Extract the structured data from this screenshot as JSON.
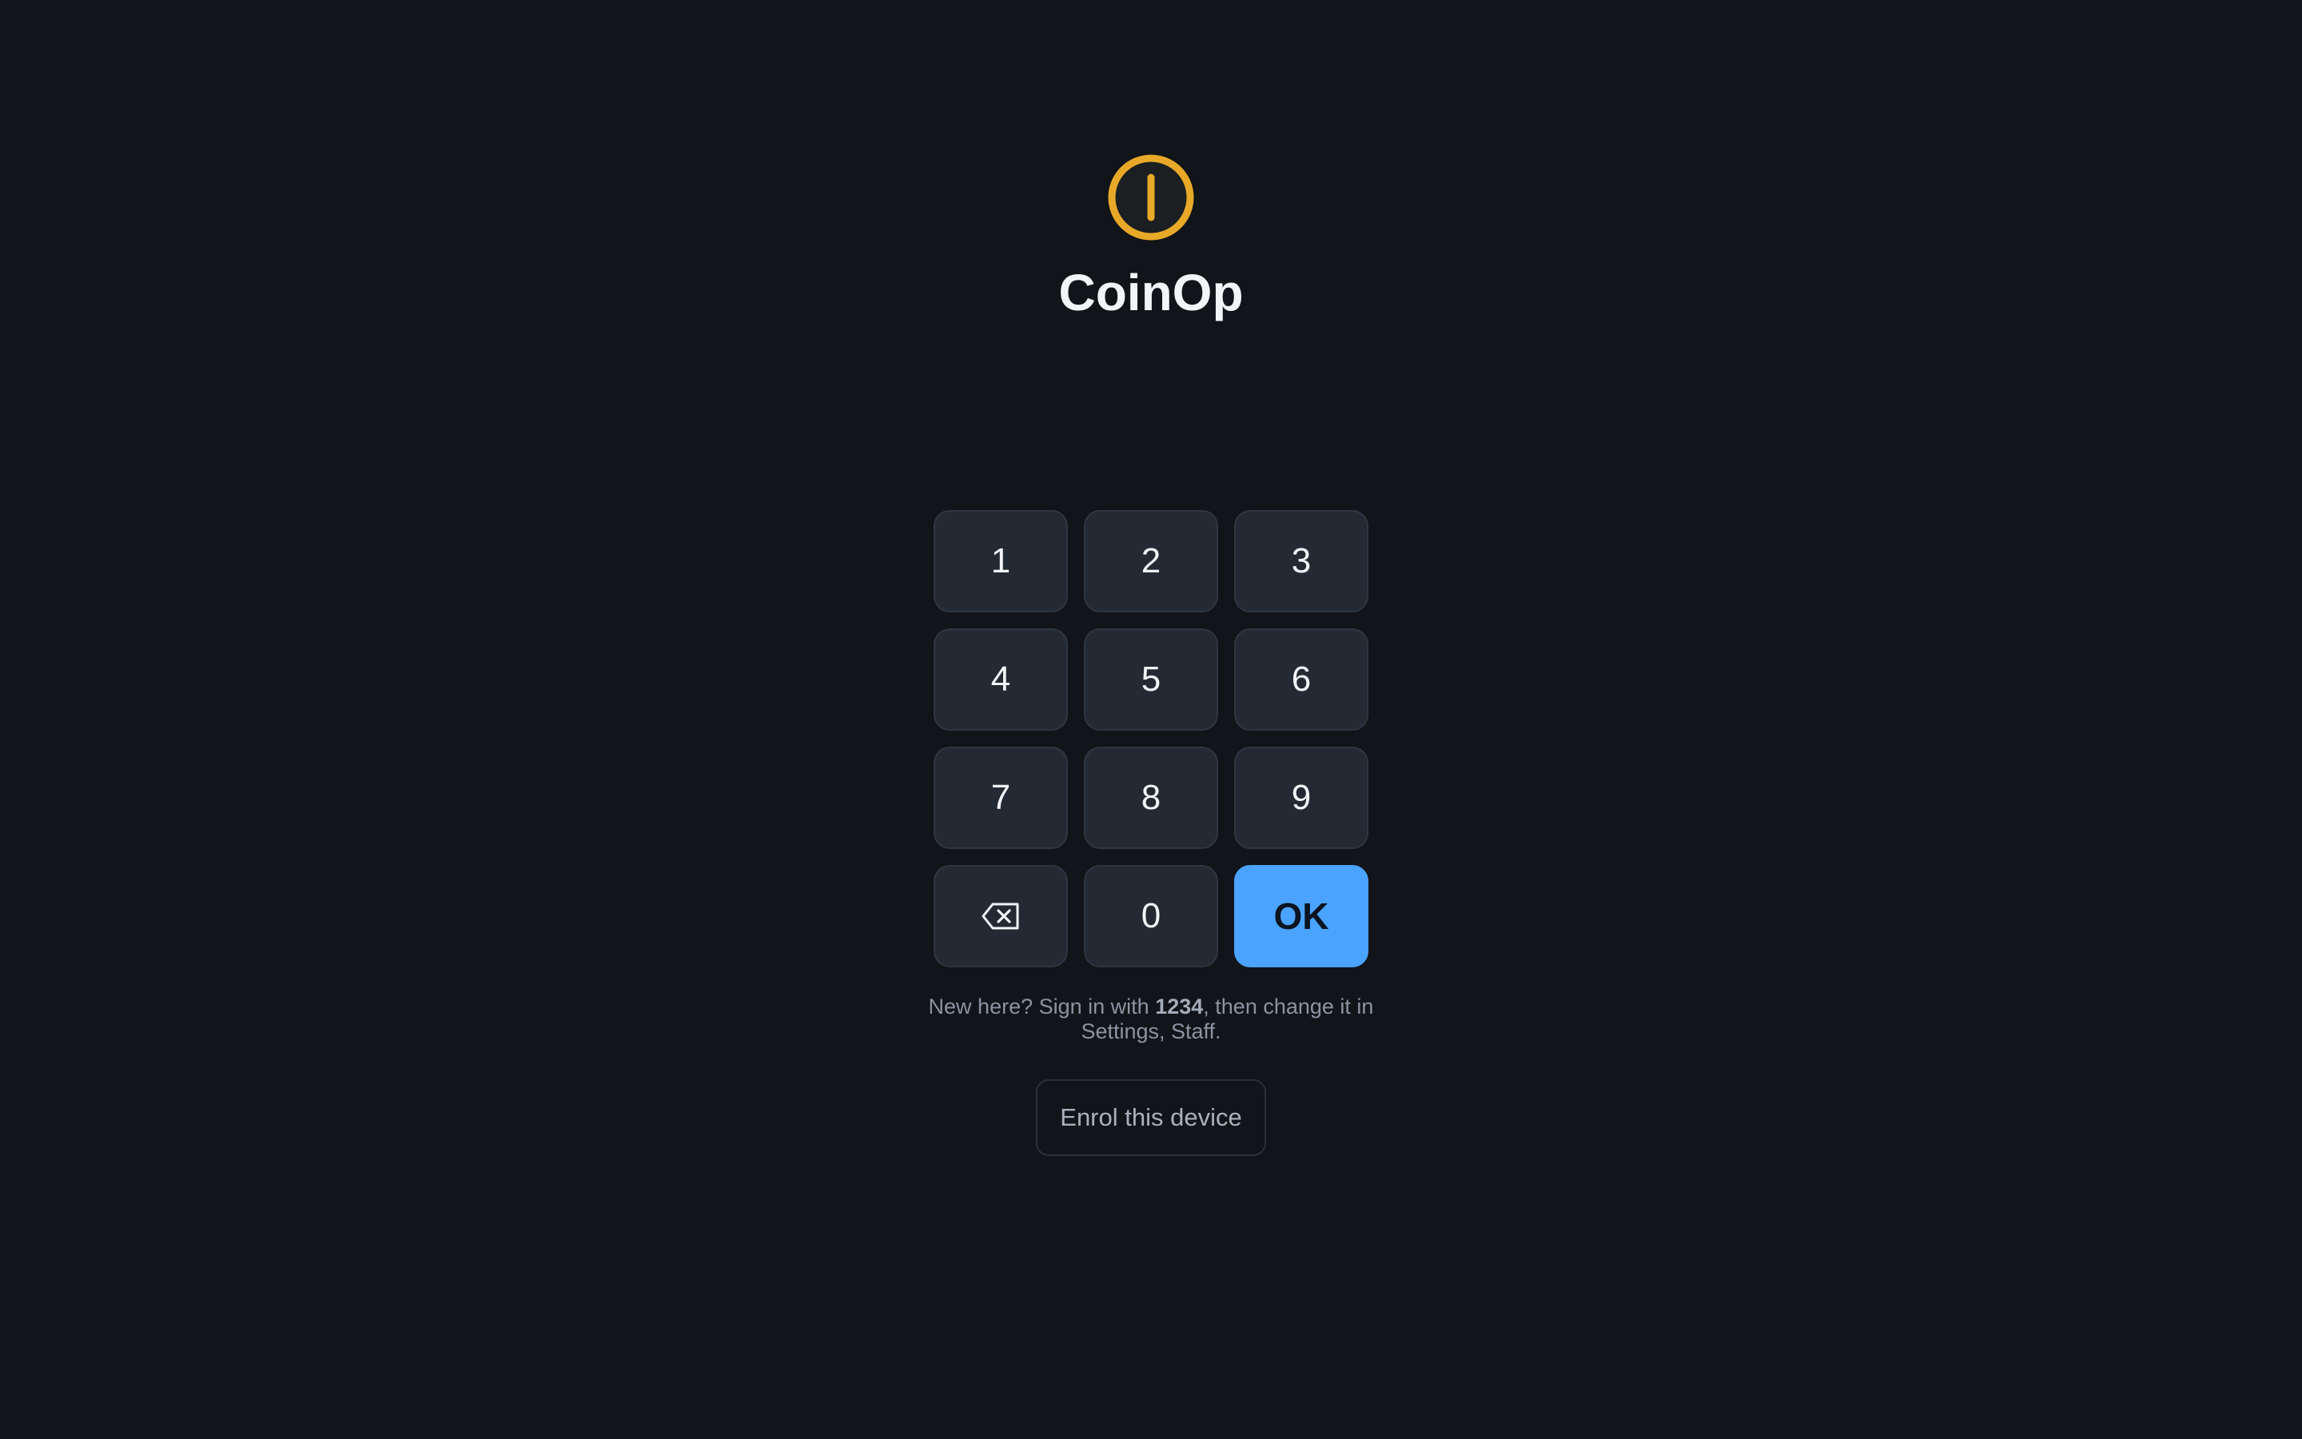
{
  "app": {
    "title": "CoinOp",
    "logo_icon": "power-coin-icon",
    "accent_color": "#e8a928"
  },
  "keypad": {
    "keys": [
      "1",
      "2",
      "3",
      "4",
      "5",
      "6",
      "7",
      "8",
      "9"
    ],
    "zero": "0",
    "ok": "OK",
    "backspace_icon": "backspace-icon",
    "ok_color": "#4aa3ff"
  },
  "hint": {
    "prefix": "New here? Sign in with ",
    "pin": "1234",
    "suffix": ", then change it in Settings, Staff."
  },
  "enrol": {
    "label": "Enrol this device"
  }
}
